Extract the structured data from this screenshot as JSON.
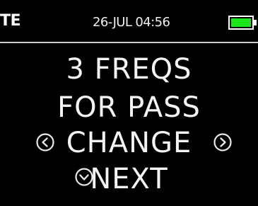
{
  "status": {
    "left_text": "TE",
    "datetime": "26-JUL 04:56",
    "battery_level": 1.0,
    "battery_color": "#19e619"
  },
  "screen": {
    "line1": "3 FREQS",
    "line2": "FOR PASS",
    "change_label": "CHANGE",
    "next_label": "NEXT"
  },
  "icons": {
    "prev": "chevron-left-circle-icon",
    "next_value": "chevron-right-circle-icon",
    "next_screen": "chevron-down-circle-icon"
  }
}
